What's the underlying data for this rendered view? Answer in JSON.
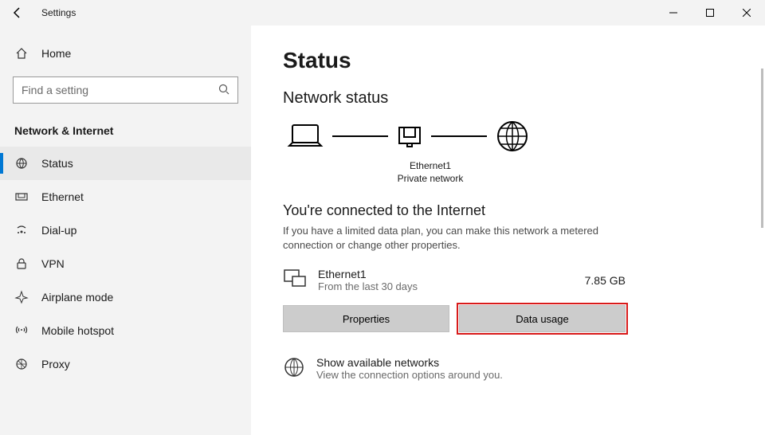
{
  "app": {
    "title": "Settings"
  },
  "sidebar": {
    "home": "Home",
    "search_placeholder": "Find a setting",
    "category": "Network & Internet",
    "items": [
      {
        "icon": "status",
        "label": "Status",
        "active": true
      },
      {
        "icon": "ethernet",
        "label": "Ethernet",
        "active": false
      },
      {
        "icon": "dialup",
        "label": "Dial-up",
        "active": false
      },
      {
        "icon": "vpn",
        "label": "VPN",
        "active": false
      },
      {
        "icon": "airplane",
        "label": "Airplane mode",
        "active": false
      },
      {
        "icon": "hotspot",
        "label": "Mobile hotspot",
        "active": false
      },
      {
        "icon": "proxy",
        "label": "Proxy",
        "active": false
      }
    ]
  },
  "main": {
    "title": "Status",
    "subtitle": "Network status",
    "diagram": {
      "adapter": "Ethernet1",
      "network_type": "Private network"
    },
    "connected_heading": "You're connected to the Internet",
    "connected_desc": "If you have a limited data plan, you can make this network a metered connection or change other properties.",
    "connection": {
      "name": "Ethernet1",
      "period": "From the last 30 days",
      "usage": "7.85 GB"
    },
    "buttons": {
      "properties": "Properties",
      "data_usage": "Data usage"
    },
    "available_networks": {
      "title": "Show available networks",
      "desc": "View the connection options around you."
    }
  }
}
